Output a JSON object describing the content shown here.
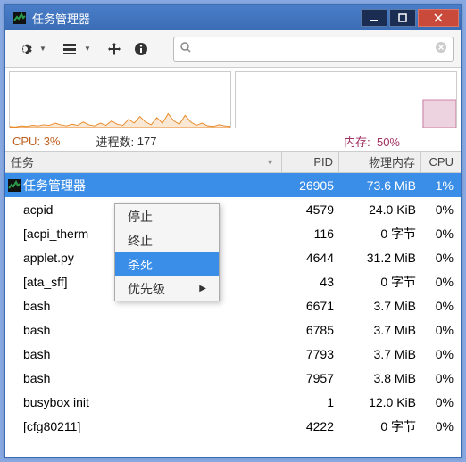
{
  "window": {
    "title": "任务管理器"
  },
  "search": {
    "placeholder": ""
  },
  "stats": {
    "cpu_label": "CPU:",
    "cpu_value": "3%",
    "proc_label": "进程数:",
    "proc_value": "177",
    "mem_label": "内存:",
    "mem_value": "50%"
  },
  "columns": {
    "task": "任务",
    "pid": "PID",
    "mem": "物理内存",
    "cpu": "CPU"
  },
  "processes": [
    {
      "name": "任务管理器",
      "pid": "26905",
      "mem": "73.6 MiB",
      "cpu": "1%",
      "selected": true,
      "has_icon": true
    },
    {
      "name": "acpid",
      "pid": "4579",
      "mem": "24.0 KiB",
      "cpu": "0%"
    },
    {
      "name": "[acpi_therm",
      "pid": "116",
      "mem": "0 字节",
      "cpu": "0%"
    },
    {
      "name": "applet.py",
      "pid": "4644",
      "mem": "31.2 MiB",
      "cpu": "0%"
    },
    {
      "name": "[ata_sff]",
      "pid": "43",
      "mem": "0 字节",
      "cpu": "0%"
    },
    {
      "name": "bash",
      "pid": "6671",
      "mem": "3.7 MiB",
      "cpu": "0%"
    },
    {
      "name": "bash",
      "pid": "6785",
      "mem": "3.7 MiB",
      "cpu": "0%"
    },
    {
      "name": "bash",
      "pid": "7793",
      "mem": "3.7 MiB",
      "cpu": "0%"
    },
    {
      "name": "bash",
      "pid": "7957",
      "mem": "3.8 MiB",
      "cpu": "0%"
    },
    {
      "name": "busybox init",
      "pid": "1",
      "mem": "12.0 KiB",
      "cpu": "0%"
    },
    {
      "name": "[cfg80211]",
      "pid": "4222",
      "mem": "0 字节",
      "cpu": "0%"
    }
  ],
  "context_menu": {
    "items": [
      {
        "label": "停止"
      },
      {
        "label": "终止"
      },
      {
        "label": "杀死",
        "selected": true
      },
      {
        "label": "优先级",
        "submenu": true
      }
    ]
  },
  "chart_data": [
    {
      "type": "area",
      "title": "CPU",
      "ylim": [
        0,
        100
      ],
      "color": "#e88a2a",
      "values": [
        2,
        1,
        3,
        2,
        4,
        3,
        5,
        4,
        8,
        5,
        3,
        6,
        4,
        10,
        5,
        3,
        8,
        4,
        12,
        6,
        4,
        15,
        8,
        20,
        10,
        5,
        18,
        8,
        25,
        12,
        6,
        22,
        10,
        4,
        8,
        3,
        2,
        5,
        3,
        2
      ]
    },
    {
      "type": "area",
      "title": "Memory",
      "ylim": [
        0,
        100
      ],
      "color": "#c97aa0",
      "values": [
        50,
        50,
        50,
        50,
        50,
        50,
        50,
        50,
        50,
        50,
        50,
        50,
        50,
        50,
        50,
        50,
        50,
        50,
        50,
        50,
        50,
        50,
        50,
        50,
        50,
        50,
        50,
        50,
        50,
        50,
        50,
        50,
        50,
        50,
        50,
        50,
        50,
        50,
        50,
        50
      ]
    }
  ]
}
